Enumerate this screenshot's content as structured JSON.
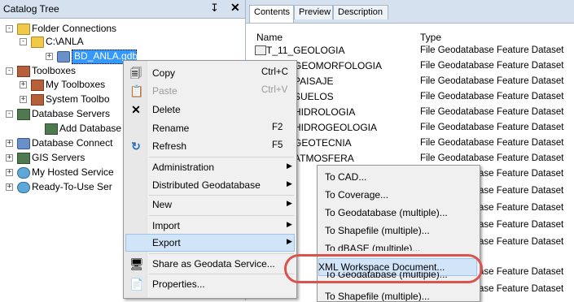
{
  "catalog": {
    "title": "Catalog Tree",
    "pin_glyph": "↧",
    "close_glyph": "✕",
    "items": [
      {
        "label": "Folder Connections",
        "icon": "folder-connection-icon",
        "exp": "-"
      },
      {
        "label": "C:\\ANLA",
        "icon": "folder-icon",
        "exp": "-"
      },
      {
        "label": "BD_ANLA.gdb",
        "icon": "geodatabase-icon",
        "exp": "+"
      },
      {
        "label": "Toolboxes",
        "icon": "toolbox-icon",
        "exp": "-"
      },
      {
        "label": "My Toolboxes",
        "icon": "toolbox-icon",
        "exp": "+"
      },
      {
        "label": "System Toolbo",
        "icon": "toolbox-icon",
        "exp": "+"
      },
      {
        "label": "Database Servers",
        "icon": "database-server-icon",
        "exp": "-"
      },
      {
        "label": "Add Database",
        "icon": "add-database-icon",
        "exp": ""
      },
      {
        "label": "Database Connect",
        "icon": "database-connection-icon",
        "exp": "+"
      },
      {
        "label": "GIS Servers",
        "icon": "gis-server-icon",
        "exp": "+"
      },
      {
        "label": "My Hosted Service",
        "icon": "hosted-service-icon",
        "exp": "+"
      },
      {
        "label": "Ready-To-Use Ser",
        "icon": "ready-service-icon",
        "exp": "+"
      }
    ]
  },
  "tabs": [
    "Contents",
    "Preview",
    "Description"
  ],
  "list": {
    "col_name": "Name",
    "col_type": "Type",
    "rows": [
      {
        "name": "T_11_GEOLOGIA",
        "type": "File Geodatabase Feature Dataset"
      },
      {
        "name": "GEOMORFOLOGIA",
        "type": "File Geodatabase Feature Dataset"
      },
      {
        "name": "PAISAJE",
        "type": "File Geodatabase Feature Dataset"
      },
      {
        "name": "SUELOS",
        "type": "File Geodatabase Feature Dataset"
      },
      {
        "name": "HIDROLOGIA",
        "type": "File Geodatabase Feature Dataset"
      },
      {
        "name": "HIDROGEOLOGIA",
        "type": "File Geodatabase Feature Dataset"
      },
      {
        "name": "GEOTECNIA",
        "type": "File Geodatabase Feature Dataset"
      },
      {
        "name": "ATMOSFERA",
        "type": "File Geodatabase Feature Dataset"
      },
      {
        "name": "",
        "type": "ase Feature Dataset"
      },
      {
        "name": "",
        "type": "ase Feature Dataset"
      },
      {
        "name": "",
        "type": "ase Feature Dataset"
      },
      {
        "name": "",
        "type": "ase Feature Dataset"
      },
      {
        "name": "",
        "type": "ase Feature Dataset"
      },
      {
        "name": "",
        "type": "ase Feature Dataset"
      },
      {
        "name": "",
        "type": "ase Feature Dataset"
      }
    ]
  },
  "context_menu": {
    "items": [
      {
        "label": "Copy",
        "shortcut": "Ctrl+C",
        "icon": "copy-icon",
        "glyph": "🗐",
        "disabled": false
      },
      {
        "label": "Paste",
        "shortcut": "Ctrl+V",
        "icon": "paste-icon",
        "glyph": "📋",
        "disabled": true
      },
      {
        "label": "Delete",
        "shortcut": "",
        "icon": "delete-icon",
        "glyph": "✕",
        "disabled": false
      },
      {
        "label": "Rename",
        "shortcut": "F2",
        "icon": "",
        "glyph": "",
        "disabled": false
      },
      {
        "label": "Refresh",
        "shortcut": "F5",
        "icon": "refresh-icon",
        "glyph": "↻",
        "disabled": false
      },
      {
        "label": "Administration",
        "arrow": true
      },
      {
        "label": "Distributed Geodatabase",
        "arrow": true
      },
      {
        "label": "New",
        "arrow": true
      },
      {
        "label": "Import",
        "arrow": true
      },
      {
        "label": "Export",
        "arrow": true,
        "highlighted": true
      },
      {
        "label": "Share as Geodata Service...",
        "icon": "share-service-icon",
        "glyph": "🖥"
      },
      {
        "label": "Properties...",
        "icon": "properties-icon",
        "glyph": "📄"
      }
    ],
    "arrow_glyph": "▶"
  },
  "submenu": {
    "items": [
      {
        "label": "To CAD..."
      },
      {
        "label": "To Coverage..."
      },
      {
        "label": "To Geodatabase (multiple)..."
      },
      {
        "label": "To Shapefile (multiple)..."
      },
      {
        "label": "To dBASE (multiple)..."
      },
      {
        "label": "XML Workspace Document...",
        "highlighted": true,
        "icon": "xml-workspace-icon"
      },
      {
        "label": "To Geodatabase (multiple)..."
      },
      {
        "label": "To Shapefile (multiple)..."
      }
    ]
  },
  "colors": {
    "selection": "#3399ff",
    "highlight": "#d2e4f8",
    "annotation": "#d9534f"
  }
}
